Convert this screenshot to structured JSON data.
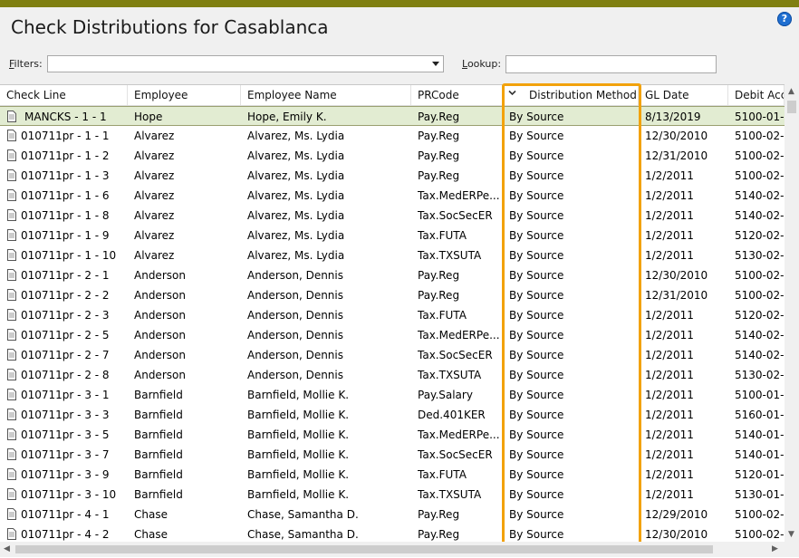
{
  "window": {
    "title": "Check Distributions for Casablanca",
    "help_icon": "question-circle-icon",
    "help_glyph": "?"
  },
  "filters": {
    "label_prefix": "",
    "label_accel": "F",
    "label_rest": "ilters:",
    "value": ""
  },
  "lookup": {
    "label_accel": "L",
    "label_rest": "ookup:",
    "value": ""
  },
  "highlight_color": "#f2a20c",
  "selected_row_color": "#e2ecd2",
  "columns": [
    "Check Line",
    "Employee",
    "Employee Name",
    "PRCode",
    "Distribution Method",
    "GL Date",
    "Debit Acc"
  ],
  "sorted_column": "Distribution Method",
  "rows": [
    [
      "MANCKS - 1 - 1",
      "Hope",
      "Hope, Emily K.",
      "Pay.Reg",
      "By Source",
      "8/13/2019",
      "5100-01-"
    ],
    [
      "010711pr - 1 - 1",
      "Alvarez",
      "Alvarez, Ms. Lydia",
      "Pay.Reg",
      "By Source",
      "12/30/2010",
      "5100-02-"
    ],
    [
      "010711pr - 1 - 2",
      "Alvarez",
      "Alvarez, Ms. Lydia",
      "Pay.Reg",
      "By Source",
      "12/31/2010",
      "5100-02-"
    ],
    [
      "010711pr - 1 - 3",
      "Alvarez",
      "Alvarez, Ms. Lydia",
      "Pay.Reg",
      "By Source",
      "1/2/2011",
      "5100-02-"
    ],
    [
      "010711pr - 1 - 6",
      "Alvarez",
      "Alvarez, Ms. Lydia",
      "Tax.MedERPe...",
      "By Source",
      "1/2/2011",
      "5140-02-"
    ],
    [
      "010711pr - 1 - 8",
      "Alvarez",
      "Alvarez, Ms. Lydia",
      "Tax.SocSecER",
      "By Source",
      "1/2/2011",
      "5140-02-"
    ],
    [
      "010711pr - 1 - 9",
      "Alvarez",
      "Alvarez, Ms. Lydia",
      "Tax.FUTA",
      "By Source",
      "1/2/2011",
      "5120-02-"
    ],
    [
      "010711pr - 1 - 10",
      "Alvarez",
      "Alvarez, Ms. Lydia",
      "Tax.TXSUTA",
      "By Source",
      "1/2/2011",
      "5130-02-"
    ],
    [
      "010711pr - 2 - 1",
      "Anderson",
      "Anderson, Dennis",
      "Pay.Reg",
      "By Source",
      "12/30/2010",
      "5100-02-"
    ],
    [
      "010711pr - 2 - 2",
      "Anderson",
      "Anderson, Dennis",
      "Pay.Reg",
      "By Source",
      "12/31/2010",
      "5100-02-"
    ],
    [
      "010711pr - 2 - 3",
      "Anderson",
      "Anderson, Dennis",
      "Tax.FUTA",
      "By Source",
      "1/2/2011",
      "5120-02-"
    ],
    [
      "010711pr - 2 - 5",
      "Anderson",
      "Anderson, Dennis",
      "Tax.MedERPe...",
      "By Source",
      "1/2/2011",
      "5140-02-"
    ],
    [
      "010711pr - 2 - 7",
      "Anderson",
      "Anderson, Dennis",
      "Tax.SocSecER",
      "By Source",
      "1/2/2011",
      "5140-02-"
    ],
    [
      "010711pr - 2 - 8",
      "Anderson",
      "Anderson, Dennis",
      "Tax.TXSUTA",
      "By Source",
      "1/2/2011",
      "5130-02-"
    ],
    [
      "010711pr - 3 - 1",
      "Barnfield",
      "Barnfield, Mollie K.",
      "Pay.Salary",
      "By Source",
      "1/2/2011",
      "5100-01-"
    ],
    [
      "010711pr - 3 - 3",
      "Barnfield",
      "Barnfield, Mollie K.",
      "Ded.401KER",
      "By Source",
      "1/2/2011",
      "5160-01-"
    ],
    [
      "010711pr - 3 - 5",
      "Barnfield",
      "Barnfield, Mollie K.",
      "Tax.MedERPe...",
      "By Source",
      "1/2/2011",
      "5140-01-"
    ],
    [
      "010711pr - 3 - 7",
      "Barnfield",
      "Barnfield, Mollie K.",
      "Tax.SocSecER",
      "By Source",
      "1/2/2011",
      "5140-01-"
    ],
    [
      "010711pr - 3 - 9",
      "Barnfield",
      "Barnfield, Mollie K.",
      "Tax.FUTA",
      "By Source",
      "1/2/2011",
      "5120-01-"
    ],
    [
      "010711pr - 3 - 10",
      "Barnfield",
      "Barnfield, Mollie K.",
      "Tax.TXSUTA",
      "By Source",
      "1/2/2011",
      "5130-01-"
    ],
    [
      "010711pr - 4 - 1",
      "Chase",
      "Chase, Samantha D.",
      "Pay.Reg",
      "By Source",
      "12/29/2010",
      "5100-02-"
    ],
    [
      "010711pr - 4 - 2",
      "Chase",
      "Chase, Samantha D.",
      "Pay.Reg",
      "By Source",
      "12/30/2010",
      "5100-02-"
    ]
  ]
}
